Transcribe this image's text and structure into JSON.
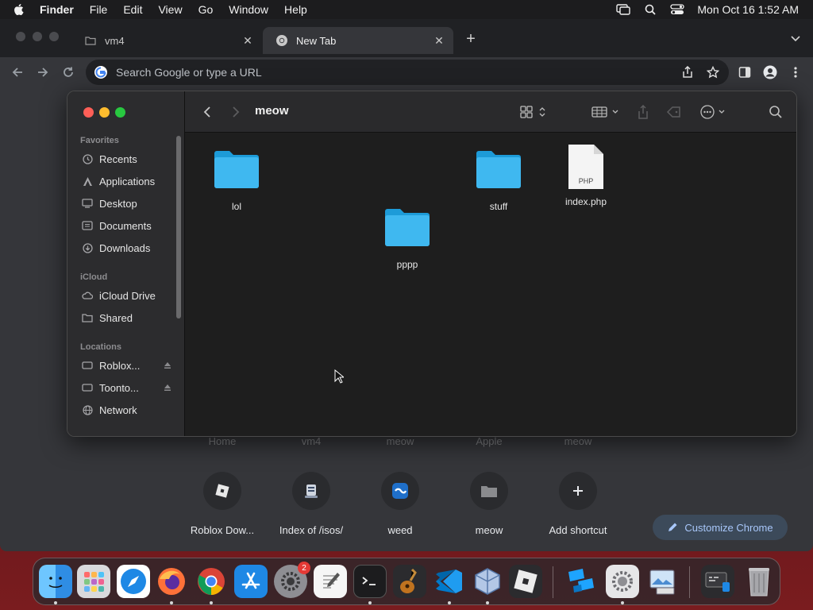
{
  "menubar": {
    "app_name": "Finder",
    "items": [
      "File",
      "Edit",
      "View",
      "Go",
      "Window",
      "Help"
    ],
    "clock": "Mon Oct 16  1:52 AM"
  },
  "chrome": {
    "tabs": [
      {
        "label": "vm4",
        "active": false
      },
      {
        "label": "New Tab",
        "active": true
      }
    ],
    "omnibox_placeholder": "Search Google or type a URL",
    "ntp_top_labels": [
      "Home",
      "vm4",
      "meow",
      "Apple",
      "meow"
    ],
    "shortcuts": [
      {
        "label": "Roblox Dow...",
        "icon": "roblox-icon"
      },
      {
        "label": "Index of /isos/",
        "icon": "server-icon"
      },
      {
        "label": "weed",
        "icon": "weed-icon"
      },
      {
        "label": "meow",
        "icon": "folder-icon"
      },
      {
        "label": "Add shortcut",
        "icon": "plus-icon"
      }
    ],
    "customize_label": "Customize Chrome"
  },
  "finder": {
    "title": "meow",
    "sections": {
      "favorites": "Favorites",
      "icloud": "iCloud",
      "locations": "Locations"
    },
    "favorites": [
      {
        "label": "Recents",
        "icon": "clock-icon"
      },
      {
        "label": "Applications",
        "icon": "applications-icon"
      },
      {
        "label": "Desktop",
        "icon": "desktop-icon"
      },
      {
        "label": "Documents",
        "icon": "document-icon"
      },
      {
        "label": "Downloads",
        "icon": "download-icon"
      }
    ],
    "icloud": [
      {
        "label": "iCloud Drive",
        "icon": "cloud-icon"
      },
      {
        "label": "Shared",
        "icon": "shared-folder-icon"
      }
    ],
    "locations": [
      {
        "label": "Roblox...",
        "icon": "drive-icon",
        "eject": true
      },
      {
        "label": "Toonto...",
        "icon": "drive-icon",
        "eject": true
      },
      {
        "label": "Network",
        "icon": "globe-icon",
        "eject": false
      }
    ],
    "files": [
      {
        "name": "lol",
        "kind": "folder"
      },
      {
        "name": "stuff",
        "kind": "folder"
      },
      {
        "name": "index.php",
        "kind": "php",
        "badge": "PHP"
      },
      {
        "name": "pppp",
        "kind": "folder"
      }
    ]
  },
  "dock": {
    "apps": [
      "finder-icon",
      "launchpad-icon",
      "safari-icon",
      "firefox-icon",
      "chrome-icon",
      "app-store-icon",
      "system-settings-icon",
      "textedit-icon",
      "terminal-icon",
      "garageband-icon",
      "vscode-icon",
      "virtualbox-icon",
      "roblox-icon",
      "roblox-studio-icon",
      "system-preferences-icon",
      "preview-icon",
      "screenshot-icon",
      "trash-icon"
    ],
    "settings_badge": "2"
  }
}
